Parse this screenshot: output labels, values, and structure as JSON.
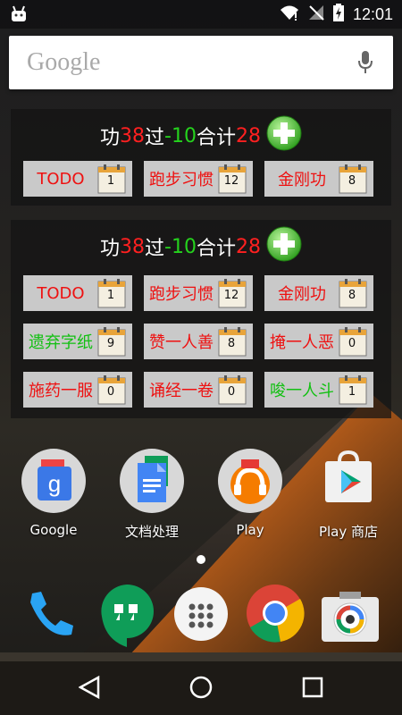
{
  "status_bar": {
    "time": "12:01"
  },
  "search": {
    "logo_text": "Google"
  },
  "widgets": [
    {
      "summary": {
        "gong_label": "功",
        "gong_value": "38",
        "guo_label": "过",
        "guo_value": "-10",
        "total_label": "合计",
        "total_value": "28"
      },
      "cells": [
        {
          "label": "TODO",
          "count": "1",
          "color": "red"
        },
        {
          "label": "跑步习惯",
          "count": "12",
          "color": "red"
        },
        {
          "label": "金刚功",
          "count": "8",
          "color": "red"
        }
      ]
    },
    {
      "summary": {
        "gong_label": "功",
        "gong_value": "38",
        "guo_label": "过",
        "guo_value": "-10",
        "total_label": "合计",
        "total_value": "28"
      },
      "cells": [
        {
          "label": "TODO",
          "count": "1",
          "color": "red"
        },
        {
          "label": "跑步习惯",
          "count": "12",
          "color": "red"
        },
        {
          "label": "金刚功",
          "count": "8",
          "color": "red"
        },
        {
          "label": "遗弃字纸",
          "count": "9",
          "color": "green"
        },
        {
          "label": "赞一人善",
          "count": "8",
          "color": "red"
        },
        {
          "label": "掩一人恶",
          "count": "0",
          "color": "red"
        },
        {
          "label": "施药一服",
          "count": "0",
          "color": "red"
        },
        {
          "label": "诵经一卷",
          "count": "0",
          "color": "red"
        },
        {
          "label": "唆一人斗",
          "count": "1",
          "color": "green"
        }
      ]
    }
  ],
  "apps": [
    {
      "label": "Google",
      "icon": "google-folder-icon"
    },
    {
      "label": "文档处理",
      "icon": "docs-folder-icon"
    },
    {
      "label": "Play",
      "icon": "play-folder-icon"
    },
    {
      "label": "Play 商店",
      "icon": "play-store-icon"
    }
  ],
  "dock": [
    "phone-icon",
    "hangouts-icon",
    "app-drawer-icon",
    "chrome-icon",
    "camera-icon"
  ],
  "colors": {
    "red": "#ee1111",
    "green": "#12c012",
    "cell_bg": "#c9c9c9"
  }
}
